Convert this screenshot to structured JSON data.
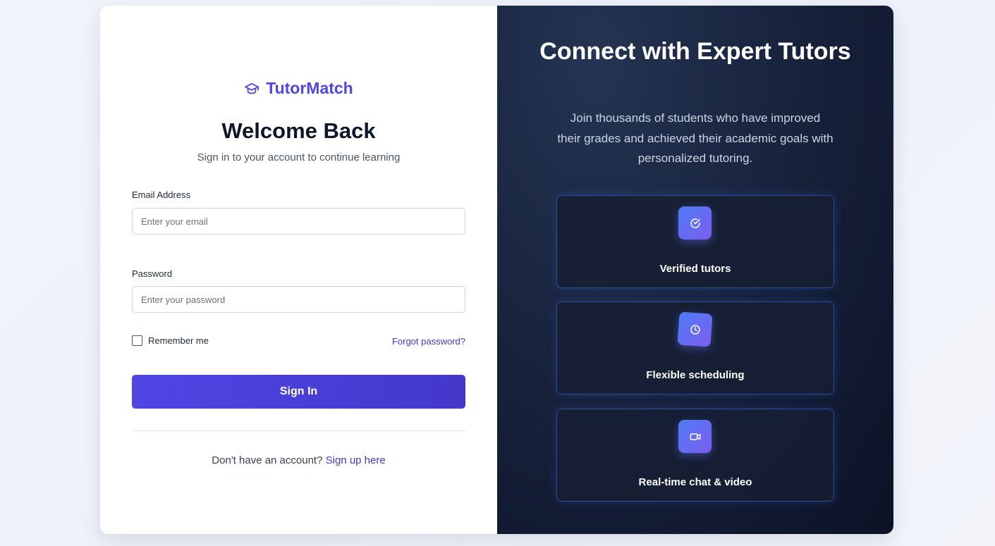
{
  "brand": {
    "name": "TutorMatch",
    "color": "#4f46e5"
  },
  "login": {
    "title": "Welcome Back",
    "subtitle": "Sign in to your account to continue learning",
    "email_label": "Email Address",
    "email_placeholder": "Enter your email",
    "email_value": "",
    "password_label": "Password",
    "password_placeholder": "Enter your password",
    "password_value": "",
    "remember_label": "Remember me",
    "remember_checked": false,
    "forgot_label": "Forgot password?",
    "signin_label": "Sign In",
    "signup_prompt": "Don't have an account?",
    "signup_link": "Sign up here"
  },
  "promo": {
    "title": "Connect with Expert Tutors",
    "subtitle": "Join thousands of students who have improved their grades and achieved their academic goals with personalized tutoring.",
    "features": [
      {
        "label": "Verified tutors",
        "icon": "check-circle-icon"
      },
      {
        "label": "Flexible scheduling",
        "icon": "clock-icon"
      },
      {
        "label": "Real-time chat & video",
        "icon": "video-icon"
      }
    ]
  },
  "colors": {
    "accent": "#4f46e5",
    "link": "#4338ca",
    "panel_dark": "#111a30",
    "feature_border": "#3b6de2"
  }
}
